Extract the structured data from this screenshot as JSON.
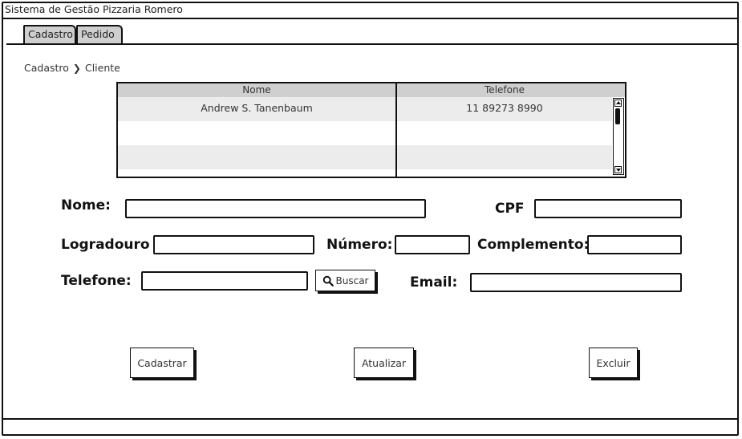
{
  "window": {
    "title": "Sistema de Gestão Pizzaria Romero"
  },
  "tabs": [
    {
      "label": "Cadastro"
    },
    {
      "label": "Pedido"
    }
  ],
  "breadcrumb": {
    "items": [
      "Cadastro",
      "Cliente"
    ]
  },
  "table": {
    "columns": [
      "Nome",
      "Telefone"
    ],
    "rows": [
      [
        "Andrew S. Tanenbaum",
        "11 89273 8990"
      ]
    ]
  },
  "form": {
    "nome_label": "Nome:",
    "cpf_label": "CPF",
    "logradouro_label": "Logradouro",
    "numero_label": "Número:",
    "complemento_label": "Complemento:",
    "telefone_label": "Telefone:",
    "email_label": "Email:",
    "buscar_label": "Buscar"
  },
  "actions": {
    "cadastrar": "Cadastrar",
    "atualizar": "Atualizar",
    "excluir": "Excluir"
  }
}
